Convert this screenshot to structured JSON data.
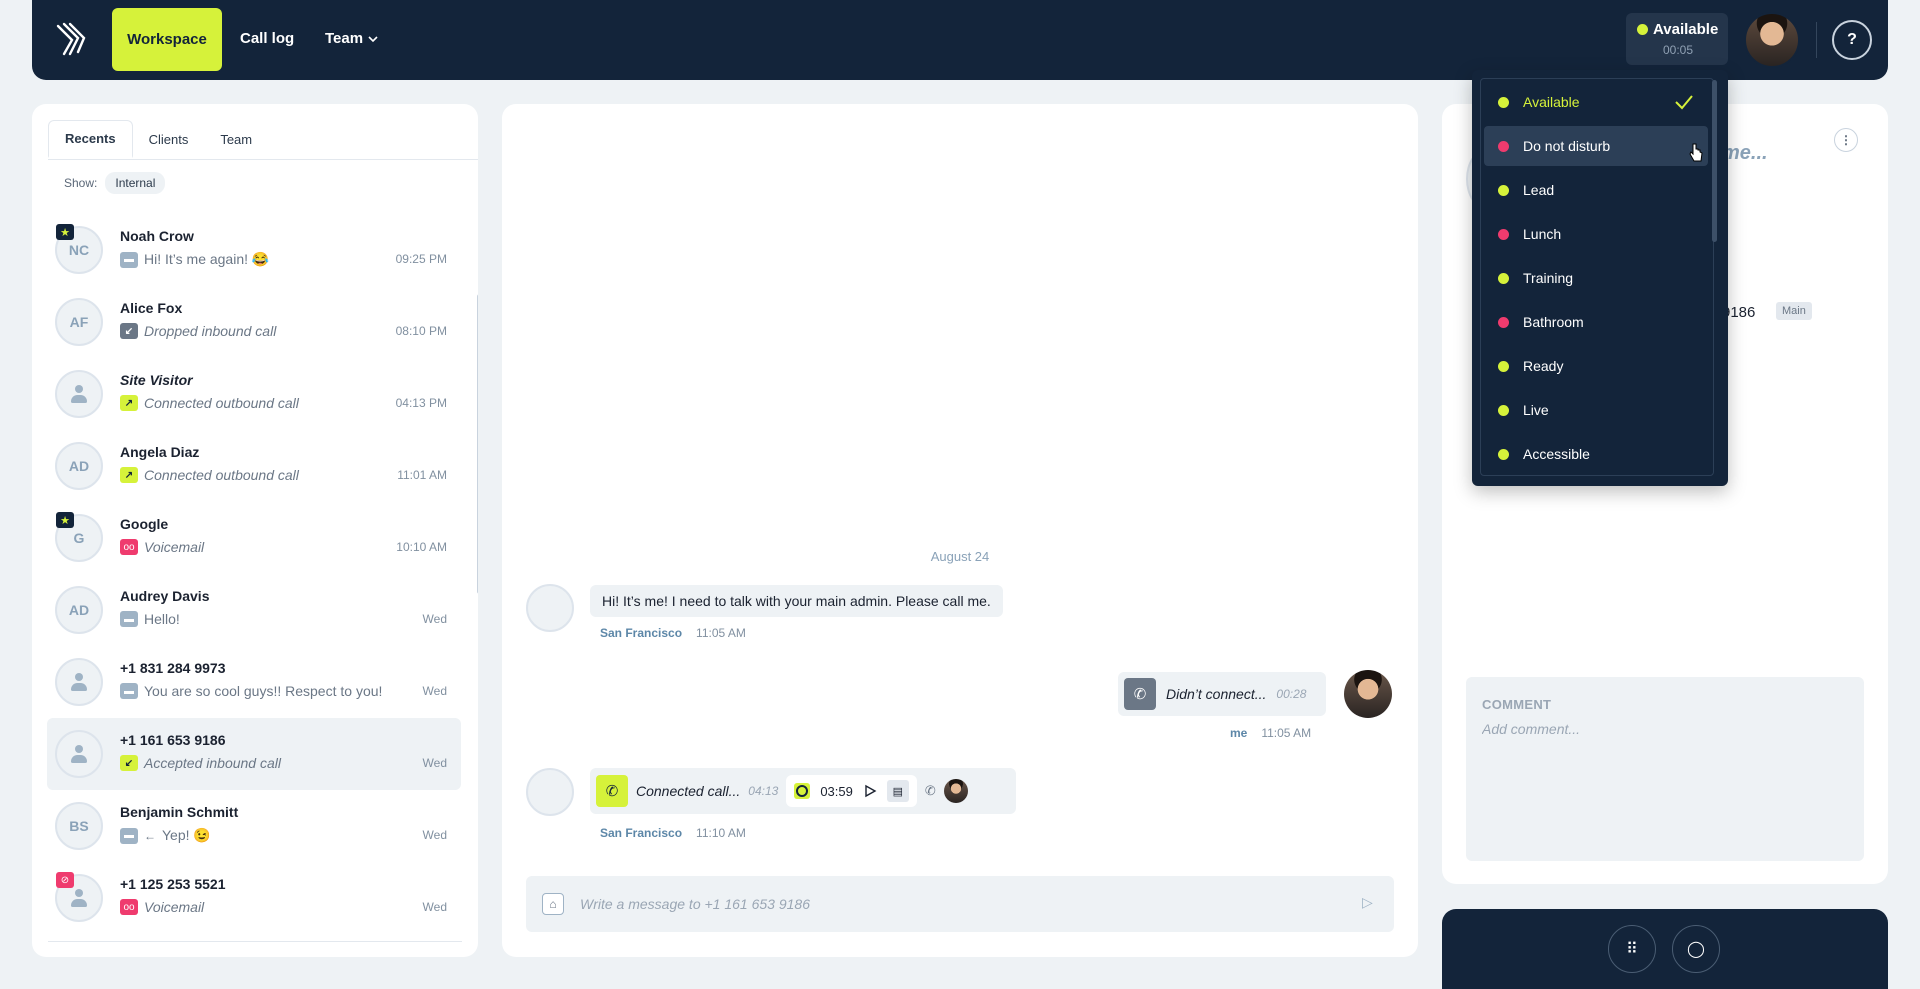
{
  "nav": {
    "workspace": "Workspace",
    "call_log": "Call log",
    "team": "Team",
    "status_label": "Available",
    "status_timer": "00:05",
    "status_color": "#d6f23a",
    "help_icon": "?"
  },
  "left": {
    "tabs": [
      "Recents",
      "Clients",
      "Team"
    ],
    "show_label": "Show:",
    "show_filter": "Internal",
    "items": [
      {
        "initials": "NC",
        "name": "Noah Crow",
        "sub": "Hi! It’s me again! 😂",
        "time": "09:25 PM",
        "icon": "message-icon",
        "badge": "star"
      },
      {
        "initials": "AF",
        "name": "Alice Fox",
        "sub": "Dropped inbound call",
        "time": "08:10 PM",
        "icon": "inbound-dropped-icon"
      },
      {
        "initials": "",
        "name": "Site Visitor",
        "sub": "Connected outbound call",
        "time": "04:13 PM",
        "icon": "outbound-call-icon"
      },
      {
        "initials": "AD",
        "name": "Angela Diaz",
        "sub": "Connected outbound call",
        "time": "11:01 AM",
        "icon": "outbound-call-icon"
      },
      {
        "initials": "G",
        "name": "Google",
        "sub": "Voicemail",
        "time": "10:10 AM",
        "icon": "voicemail-icon",
        "badge": "star"
      },
      {
        "initials": "AD",
        "name": "Audrey Davis",
        "sub": "Hello!",
        "time": "Wed",
        "icon": "message-icon"
      },
      {
        "initials": "",
        "name": "+1 831 284 9973",
        "sub": "You are so cool guys!! Respect to you!",
        "time": "Wed",
        "icon": "message-icon"
      },
      {
        "initials": "",
        "name": "+1 161 653 9186",
        "sub": "Accepted inbound call",
        "time": "Wed",
        "icon": "inbound-accepted-icon"
      },
      {
        "initials": "BS",
        "name": "Benjamin Schmitt",
        "sub": "Yep! 😉",
        "time": "Wed",
        "icon": "message-icon"
      },
      {
        "initials": "",
        "name": "+1 125 253 5521",
        "sub": "Voicemail",
        "time": "Wed",
        "icon": "voicemail-icon",
        "badge": "blocked"
      }
    ]
  },
  "chat": {
    "date": "August 24",
    "msg1": {
      "text": "Hi! It’s me! I need to talk with your main admin. Please call me.",
      "location": "San Francisco",
      "time": "11:05 AM"
    },
    "msg2": {
      "text": "Didn’t connect...",
      "duration": "00:28",
      "sender": "me",
      "time": "11:05 AM"
    },
    "msg3": {
      "text": "Connected call...",
      "duration": "04:13",
      "recording": "03:59",
      "location": "San Francisco",
      "time": "11:10 AM"
    },
    "composer_placeholder": "Write a message to +1 161 653 9186"
  },
  "right": {
    "name_partial": "me...",
    "phone_partial": "9186",
    "phone_tag": "Main",
    "comment_label": "COMMENT",
    "comment_placeholder": "Add comment..."
  },
  "status_menu": {
    "items": [
      {
        "label": "Available",
        "color": "#d6f23a",
        "selected": true
      },
      {
        "label": "Do not disturb",
        "color": "#ef3b6e",
        "hover": true
      },
      {
        "label": "Lead",
        "color": "#d6f23a"
      },
      {
        "label": "Lunch",
        "color": "#ef3b6e"
      },
      {
        "label": "Training",
        "color": "#d6f23a"
      },
      {
        "label": "Bathroom",
        "color": "#ef3b6e"
      },
      {
        "label": "Ready",
        "color": "#d6f23a"
      },
      {
        "label": "Live",
        "color": "#d6f23a"
      },
      {
        "label": "Accessible",
        "color": "#d6f23a"
      }
    ]
  }
}
